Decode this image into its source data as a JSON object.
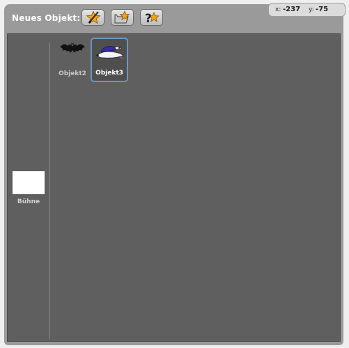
{
  "toolbar": {
    "label": "Neues Objekt:",
    "buttons": [
      {
        "name": "paint-new-sprite",
        "icon": "paintbrush-star-icon"
      },
      {
        "name": "choose-sprite-from-file",
        "icon": "folder-star-icon"
      },
      {
        "name": "random-sprite",
        "icon": "question-star-icon"
      }
    ]
  },
  "coords": {
    "x_label": "x:",
    "x_value": "-237",
    "y_label": "y:",
    "y_value": "-75"
  },
  "stage": {
    "label": "Bühne"
  },
  "sprites": [
    {
      "label": "Objekt2",
      "icon": "bat-icon",
      "selected": false
    },
    {
      "label": "Objekt3",
      "icon": "flying-dog-icon",
      "selected": true
    }
  ],
  "colors": {
    "panel": "#5f5f5f",
    "frame": "#9a9a9a",
    "selection_border": "#6e95c0"
  }
}
